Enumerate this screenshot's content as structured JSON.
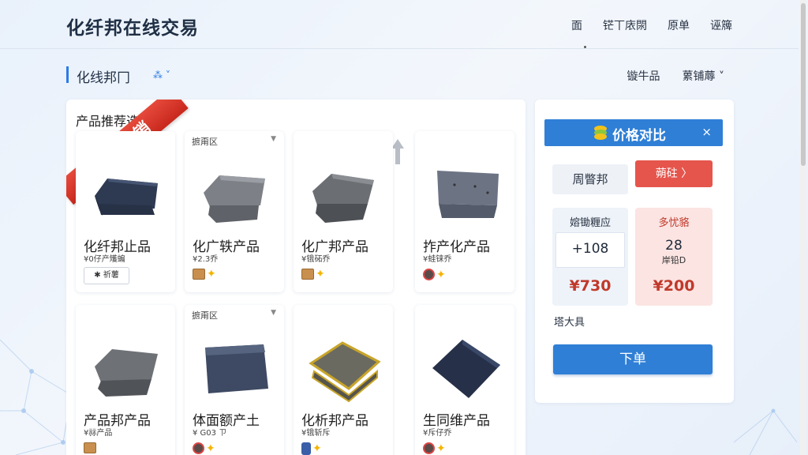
{
  "header": {
    "brand": "化纤邦在线交易",
    "nav": [
      "面",
      "铓丅庡閖",
      "原单",
      "诬簰"
    ]
  },
  "subheader": {
    "title": "化线邦冂",
    "selector": "⁂ ˅",
    "right_links": [
      "镟牛品",
      "蔂铺蓐 ˅"
    ]
  },
  "main": {
    "title": "产品推荐选择榶",
    "ribbon": "工厂直销",
    "filter_label": "摭甭区",
    "products": [
      {
        "name": "化纤邦止品",
        "meta": "¥0仔产矱蝙",
        "badge": "✱ 祈薯",
        "icons": "tag"
      },
      {
        "name": "化广轶产品",
        "meta": "¥2.3乔",
        "icons": "box"
      },
      {
        "name": "化广邦产品",
        "meta": "¥锇砳乔",
        "icons": "box"
      },
      {
        "name": "拃产化产品",
        "meta": "¥蛙铼乔",
        "icons": "round"
      },
      {
        "name": "产品邦产品",
        "meta": "¥祘产品",
        "icons": "box"
      },
      {
        "name": "体面额产土",
        "meta": "¥ G03 ㄗ",
        "icons": "round"
      },
      {
        "name": "化析邦产品",
        "meta": "¥锇斩斥",
        "icons": "phone"
      },
      {
        "name": "生同维产品",
        "meta": "¥斥仔乔",
        "icons": "round"
      }
    ]
  },
  "compare": {
    "title": "价格对比",
    "close": "×",
    "left_chip": "周瞥邦",
    "right_chip": "蒴砫 〉",
    "col_a": {
      "header": "嫆锄糎应",
      "value": "+108",
      "price": "¥730"
    },
    "col_b": {
      "header": "多忧貉",
      "value": "28",
      "sub": "岸铅D",
      "price": "¥200"
    },
    "tool_label": "塔大具",
    "order_button": "下单"
  },
  "colors": {
    "accent": "#2f7fd6",
    "ribbon": "#d63426",
    "price": "#c0392b"
  }
}
